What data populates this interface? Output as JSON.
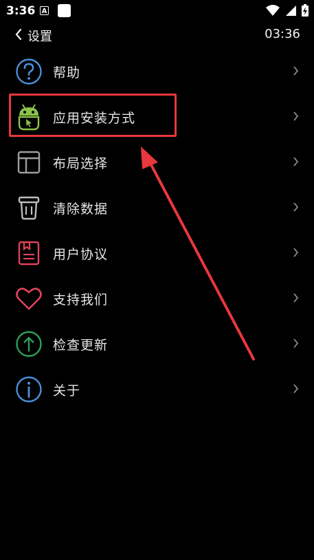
{
  "status_bar": {
    "time": "3:36",
    "notif_letter": "A"
  },
  "header": {
    "title": "设置",
    "clock": "03:36"
  },
  "menu": [
    {
      "label": "帮助",
      "icon": "help-icon",
      "color": "#4a90d9"
    },
    {
      "label": "应用安装方式",
      "icon": "android-install-icon",
      "color": "#8bc34a"
    },
    {
      "label": "布局选择",
      "icon": "layout-icon",
      "color": "#9e9e9e"
    },
    {
      "label": "清除数据",
      "icon": "trash-icon",
      "color": "#bdbdbd"
    },
    {
      "label": "用户协议",
      "icon": "agreement-icon",
      "color": "#e0435b"
    },
    {
      "label": "支持我们",
      "icon": "heart-icon",
      "color": "#e0435b"
    },
    {
      "label": "检查更新",
      "icon": "update-icon",
      "color": "#2e9e5b"
    },
    {
      "label": "关于",
      "icon": "info-icon",
      "color": "#4a90d9"
    }
  ],
  "highlight_color": "#e8383d"
}
